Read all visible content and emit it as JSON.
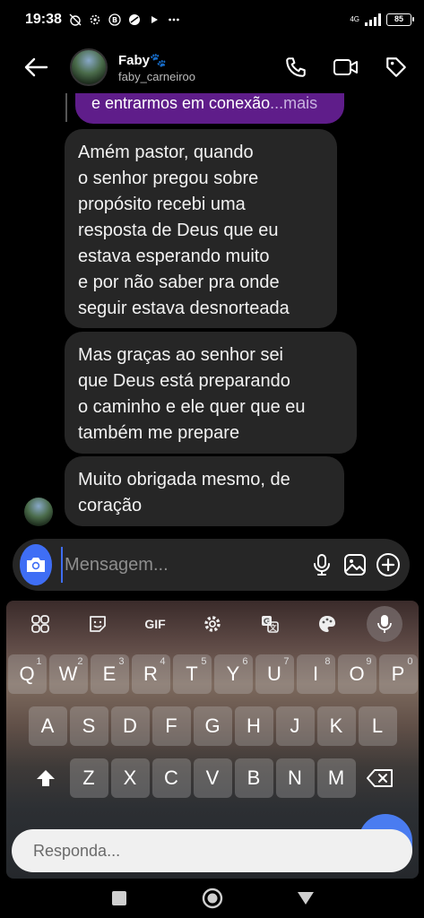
{
  "status_bar": {
    "time": "19:38",
    "network": "4G",
    "battery": "85"
  },
  "header": {
    "name": "Faby🐾",
    "username": "faby_carneiroo"
  },
  "messages": {
    "reply_preview": "e entrarmos em conexão",
    "reply_more": "...mais",
    "items": [
      "Amém pastor, quando\no senhor pregou sobre\npropósito recebi uma\nresposta de Deus que eu\nestava esperando muito\ne por não saber pra onde\nseguir estava desnorteada",
      "Mas graças ao senhor sei\nque Deus está preparando\no caminho e ele quer que eu\ntambém me prepare",
      "Muito obrigada mesmo, de\ncoração"
    ]
  },
  "composer": {
    "placeholder": "Mensagem..."
  },
  "keyboard": {
    "toolbar_gif": "GIF",
    "row1": [
      {
        "key": "Q",
        "hint": "1"
      },
      {
        "key": "W",
        "hint": "2"
      },
      {
        "key": "E",
        "hint": "3"
      },
      {
        "key": "R",
        "hint": "4"
      },
      {
        "key": "T",
        "hint": "5"
      },
      {
        "key": "Y",
        "hint": "6"
      },
      {
        "key": "U",
        "hint": "7"
      },
      {
        "key": "I",
        "hint": "8"
      },
      {
        "key": "O",
        "hint": "9"
      },
      {
        "key": "P",
        "hint": "0"
      }
    ],
    "row2": [
      "A",
      "S",
      "D",
      "F",
      "G",
      "H",
      "J",
      "K",
      "L"
    ],
    "row3": [
      "Z",
      "X",
      "C",
      "V",
      "B",
      "N",
      "M"
    ]
  },
  "reply_bar": {
    "placeholder": "Responda..."
  },
  "colors": {
    "accent": "#3f6ef5",
    "reply_bubble": "#5f1d8a",
    "message_bubble": "#262626"
  }
}
